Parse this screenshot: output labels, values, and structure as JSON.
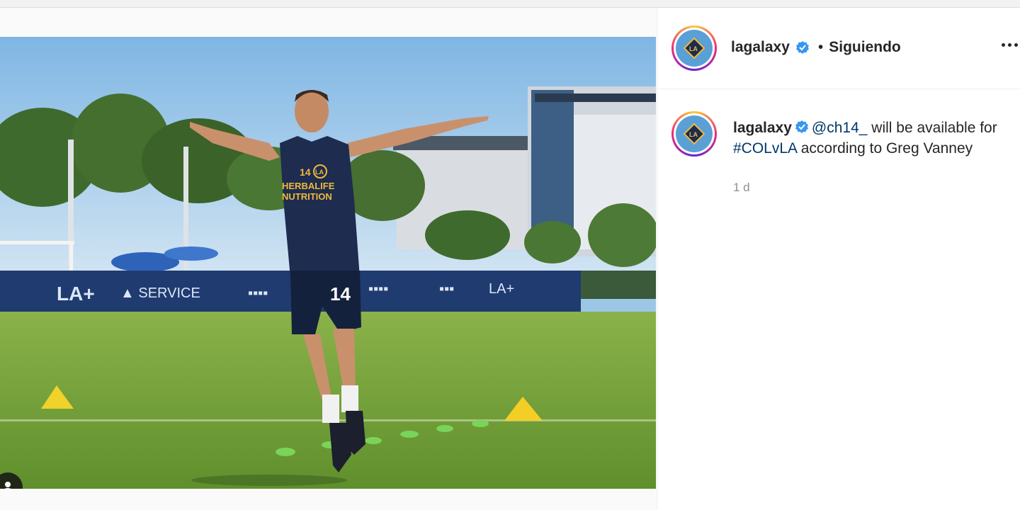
{
  "post": {
    "author": "lagalaxy",
    "separator": "•",
    "follow_status": "Siguiendo",
    "caption": {
      "username": "lagalaxy",
      "mention": "@ch14_",
      "text_1": " will be available for ",
      "hashtag": "#COLvLA",
      "text_2": " according to Greg Vanney"
    },
    "time": "1 d"
  },
  "photo": {
    "shirt_text_1": "HERBALIFE",
    "shirt_text_2": "NUTRITION",
    "number": "14",
    "crest": "LA"
  },
  "icons": {
    "verified": "verified-badge-icon",
    "more": "more-options-icon",
    "tag": "user-tag-icon"
  },
  "colors": {
    "verified": "#3897f0",
    "link": "#00376b",
    "muted": "#8e8e8e"
  }
}
